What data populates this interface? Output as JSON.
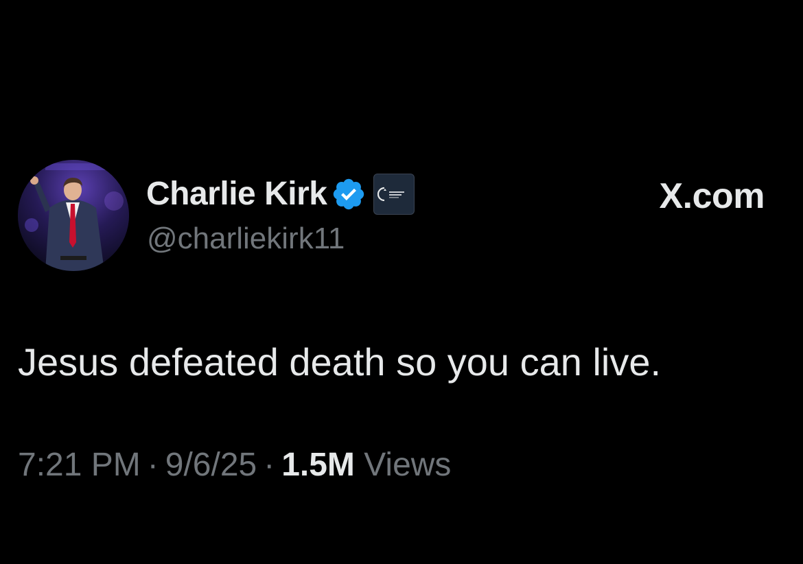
{
  "tweet": {
    "author": {
      "display_name": "Charlie Kirk",
      "handle": "@charliekirk11",
      "verified": true,
      "verified_icon": "verified-badge-icon",
      "affiliate_badge_icon": "organization-affiliate-icon"
    },
    "site_label": "X.com",
    "text": "Jesus defeated death so you can live.",
    "time": "7:21 PM",
    "date": "9/6/25",
    "separator": "·",
    "views_count": "1.5M",
    "views_label": "Views"
  },
  "colors": {
    "background": "#000000",
    "primary_text": "#e7e9ea",
    "secondary_text": "#71767b",
    "verified_blue": "#1d9bf0"
  }
}
